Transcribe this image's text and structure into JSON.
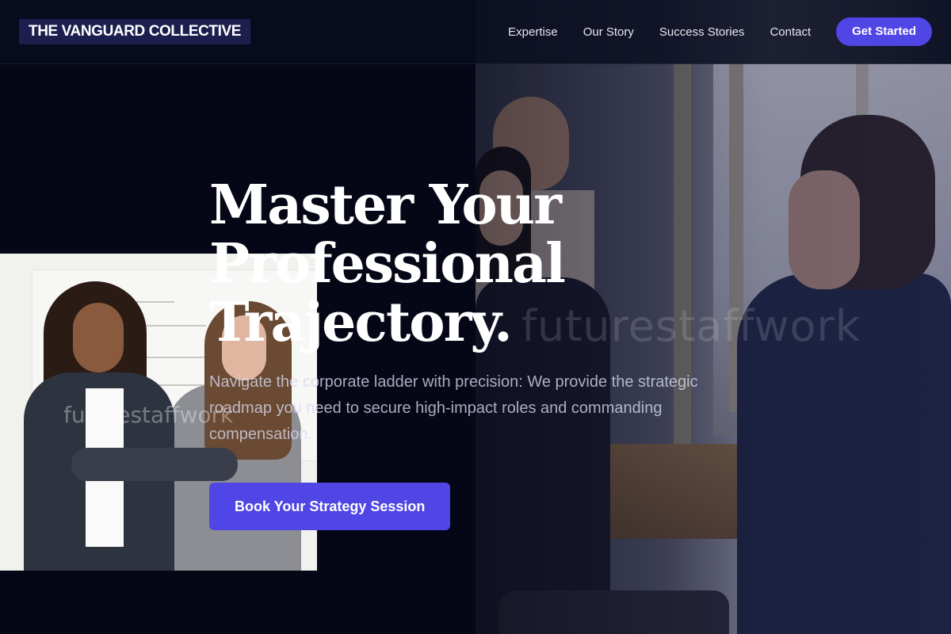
{
  "brand": {
    "name": "THE VANGUARD COLLECTIVE"
  },
  "nav": {
    "links": [
      "Expertise",
      "Our Story",
      "Success Stories",
      "Contact"
    ],
    "cta_label": "Get Started"
  },
  "hero": {
    "title_lines": [
      "Master Your",
      "Professional",
      "Trajectory."
    ],
    "subtitle": "Navigate the corporate ladder with precision: We provide the strategic roadmap you need to secure high-impact roles and commanding compensation.",
    "cta_label": "Book Your Strategy Session"
  },
  "images": {
    "office_watermark": "futurestaffwork",
    "team_watermark": "futurestaffwork"
  },
  "colors": {
    "accent": "#4f46e5",
    "background": "#050716",
    "brand_badge": "#1c1f4e"
  }
}
